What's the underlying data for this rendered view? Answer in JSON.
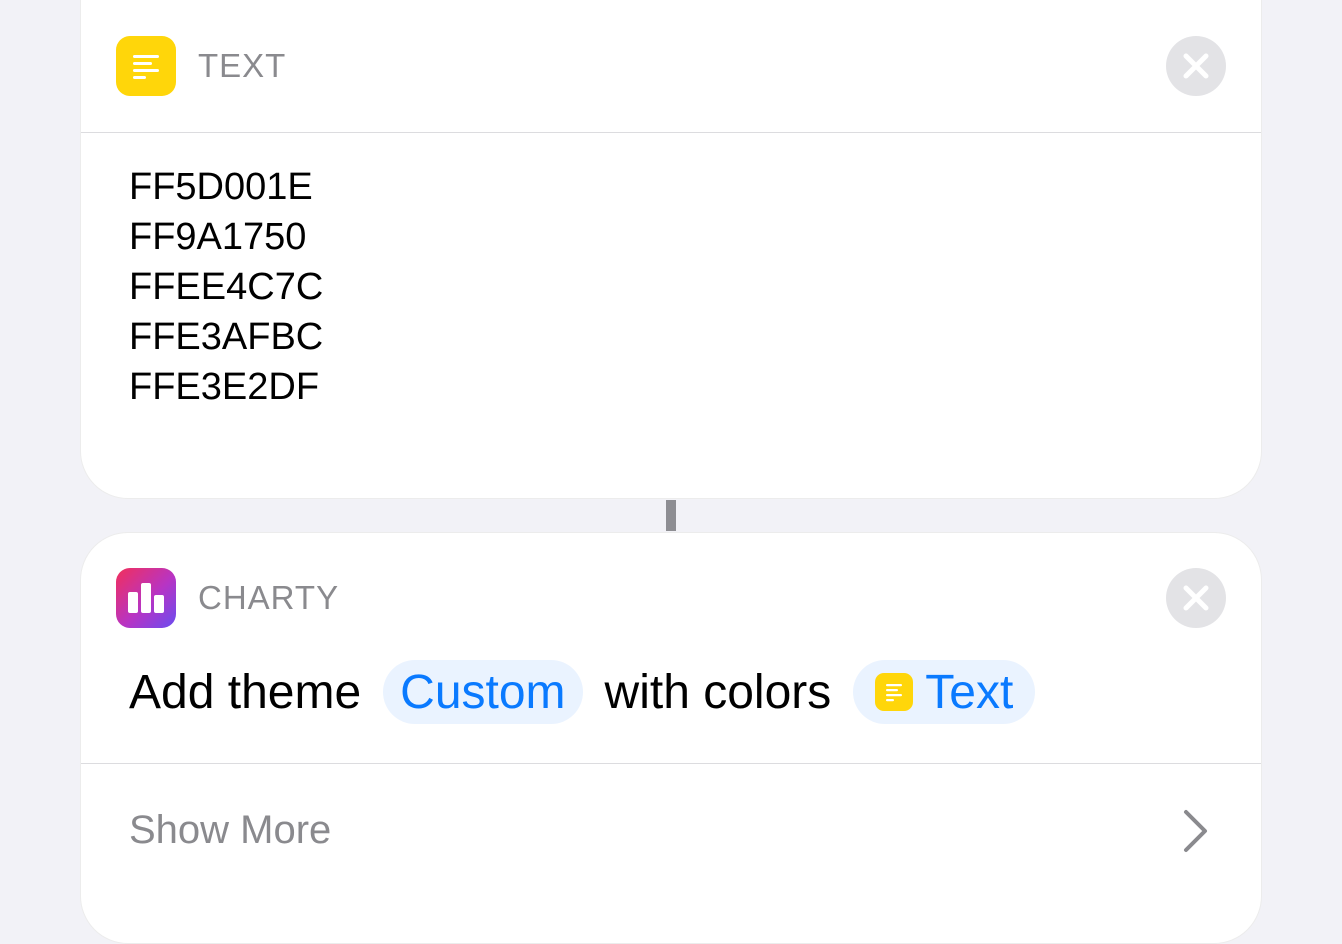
{
  "text_action": {
    "app_name": "TEXT",
    "icon": "text-lines-icon",
    "lines": [
      "FF5D001E",
      "FF9A1750",
      "FFEE4C7C",
      "FFE3AFBC",
      "FFE3E2DF"
    ],
    "close_icon": "close-icon"
  },
  "charty_action": {
    "app_name": "CHARTY",
    "icon": "bar-chart-icon",
    "prefix": "Add theme",
    "theme_token": "Custom",
    "middle": "with colors",
    "variable_token": "Text",
    "variable_icon": "text-lines-icon",
    "close_icon": "close-icon",
    "show_more_label": "Show More"
  },
  "colors": {
    "accent": "#0a7aff",
    "text_app_yellow": "#ffd60a",
    "secondary_text": "#8a8a8e"
  }
}
